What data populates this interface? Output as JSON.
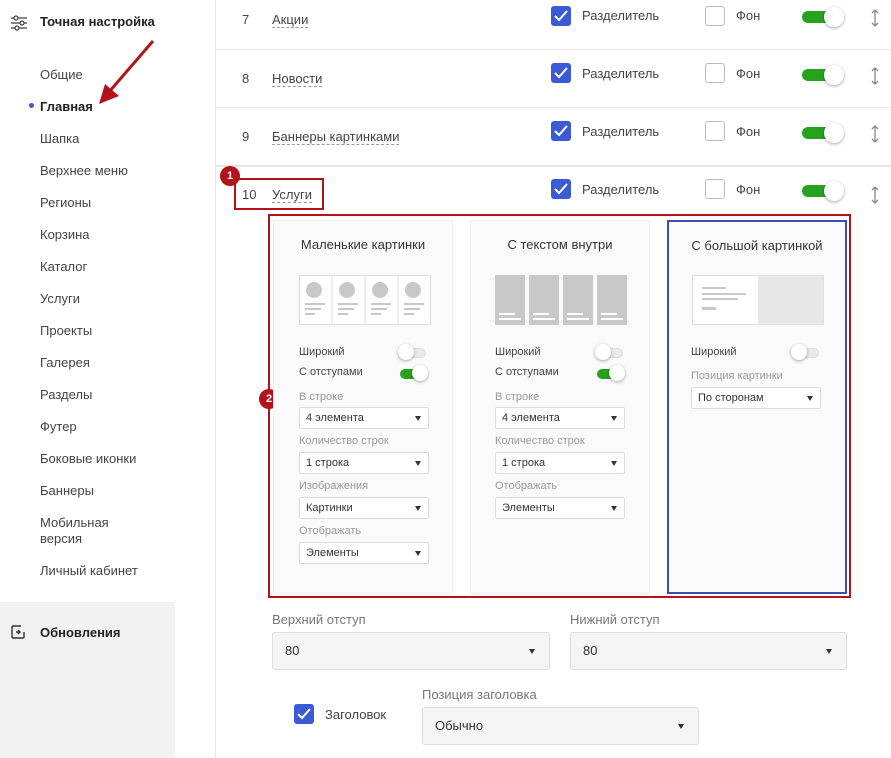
{
  "sidebar": {
    "title": "Точная настройка",
    "items": [
      "Общие",
      "Главная",
      "Шапка",
      "Верхнее меню",
      "Регионы",
      "Корзина",
      "Каталог",
      "Услуги",
      "Проекты",
      "Галерея",
      "Разделы",
      "Футер",
      "Боковые иконки",
      "Баннеры",
      "Мобильная версия",
      "Личный кабинет"
    ],
    "active_index": 1,
    "updates_label": "Обновления"
  },
  "rows": [
    {
      "num": "7",
      "name": "Акции",
      "divider_label": "Разделитель",
      "divider_checked": true,
      "bg_label": "Фон",
      "bg_checked": false,
      "enabled": true
    },
    {
      "num": "8",
      "name": "Новости",
      "divider_label": "Разделитель",
      "divider_checked": true,
      "bg_label": "Фон",
      "bg_checked": false,
      "enabled": true
    },
    {
      "num": "9",
      "name": "Баннеры картинками",
      "divider_label": "Разделитель",
      "divider_checked": true,
      "bg_label": "Фон",
      "bg_checked": false,
      "enabled": true
    },
    {
      "num": "10",
      "name": "Услуги",
      "divider_label": "Разделитель",
      "divider_checked": true,
      "bg_label": "Фон",
      "bg_checked": false,
      "enabled": true
    }
  ],
  "badges": {
    "one": "1",
    "two": "2"
  },
  "cards": [
    {
      "title": "Маленькие картинки",
      "wide_label": "Широкий",
      "wide_on": false,
      "padded_label": "С отступами",
      "padded_on": true,
      "f1_label": "В строке",
      "f1_value": "4 элемента",
      "f2_label": "Количество строк",
      "f2_value": "1 строка",
      "f3_label": "Изображения",
      "f3_value": "Картинки",
      "f4_label": "Отображать",
      "f4_value": "Элементы"
    },
    {
      "title": "С текстом внутри",
      "wide_label": "Широкий",
      "wide_on": false,
      "padded_label": "С отступами",
      "padded_on": true,
      "f1_label": "В строке",
      "f1_value": "4 элемента",
      "f2_label": "Количество строк",
      "f2_value": "1 строка",
      "f3_label": "Отображать",
      "f3_value": "Элементы"
    },
    {
      "title": "С большой картинкой",
      "wide_label": "Широкий",
      "wide_on": false,
      "pos_label": "Позиция картинки",
      "pos_value": "По сторонам"
    }
  ],
  "bottom": {
    "top_margin_label": "Верхний отступ",
    "top_margin_value": "80",
    "bottom_margin_label": "Нижний отступ",
    "bottom_margin_value": "80",
    "heading_label": "Заголовок",
    "heading_checked": true,
    "heading_pos_label": "Позиция заголовка",
    "heading_pos_value": "Обычно"
  },
  "colors": {
    "accent": "#3b5bd6",
    "toggle_on": "#27a21f",
    "annotation": "#b3121a",
    "selected_card": "#3b4fb0"
  }
}
